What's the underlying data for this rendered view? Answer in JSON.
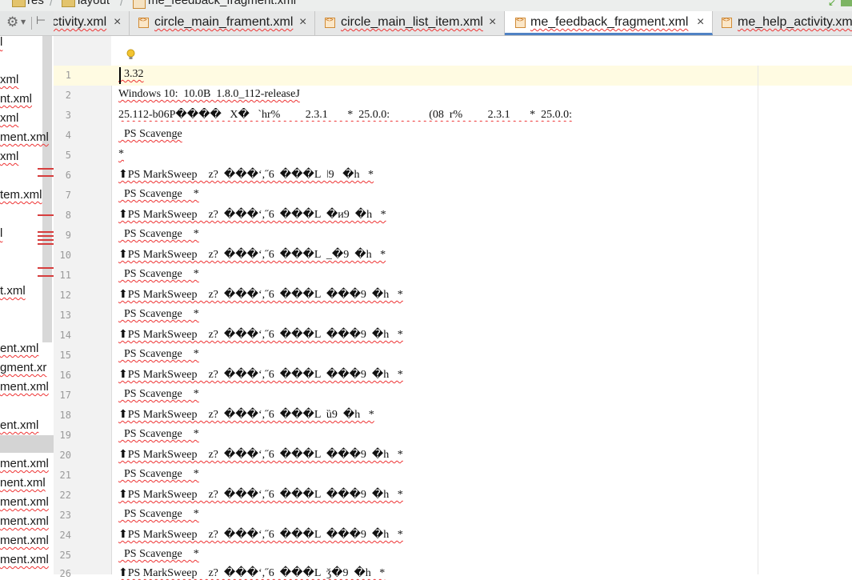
{
  "breadcrumbs": [
    "res",
    "layout",
    "me_feedback_fragment.xml"
  ],
  "tabs": [
    {
      "label": "ctivity.xml",
      "active": false
    },
    {
      "label": "circle_main_frament.xml",
      "active": false
    },
    {
      "label": "circle_main_list_item.xml",
      "active": false
    },
    {
      "label": "me_feedback_fragment.xml",
      "active": true
    },
    {
      "label": "me_help_activity.xm",
      "active": false
    }
  ],
  "tab_close_glyph": "×",
  "tree_items": [
    {
      "label": "l"
    },
    {
      "label": "xml"
    },
    {
      "label": "nt.xml"
    },
    {
      "label": "xml"
    },
    {
      "label": "ment.xml"
    },
    {
      "label": "xml"
    },
    {
      "label": "tem.xml"
    },
    {
      "label": "l"
    },
    {
      "label": "t.xml"
    },
    {
      "label": "ent.xml"
    },
    {
      "label": "gment.xr"
    },
    {
      "label": "ment.xml"
    },
    {
      "label": "ent.xml"
    },
    {
      "label": "ment.xml"
    },
    {
      "label": "nent.xml"
    },
    {
      "label": "ment.xml"
    },
    {
      "label": "ment.xml"
    },
    {
      "label": "ment.xml"
    },
    {
      "label": "ment.xml"
    }
  ],
  "line_numbers": [
    "1",
    "2",
    "3",
    "4",
    "5",
    "6",
    "7",
    "8",
    "9",
    "10",
    "11",
    "12",
    "13",
    "14",
    "15",
    "16",
    "17",
    "18",
    "19",
    "20",
    "21",
    "22",
    "23",
    "24",
    "25",
    "26"
  ],
  "code_lines": [
    "  3.32",
    "Windows 10:  10.0B  1.8.0_112-releaseJ",
    "25.112-b06P����   X�   `hr%         2.3.1       *  25.0.0:              (08  r%         2.3.1       *  25.0.0:",
    "  PS Scavenge",
    "*",
    "⬆PS MarkSweep    z?  ���ʻ,˝6  ���L  ǀ9   �h   *",
    "  PS Scavenge    *",
    "⬆PS MarkSweep    z?  ���ʻ,˝6  ���L  �и9  �h   *",
    "  PS Scavenge    *",
    "⬆PS MarkSweep    z?  ���ʻ,˝6  ���L  _�9  �h   *",
    "  PS Scavenge    *",
    "⬆PS MarkSweep    z?  ���ʻ,˝6  ���L  ���9  �h   *",
    "  PS Scavenge    *",
    "⬆PS MarkSweep    z?  ���ʻ,˝6  ���L  ���9  �h   *",
    "  PS Scavenge    *",
    "⬆PS MarkSweep    z?  ���ʻ,˝6  ���L  ���9  �h   *",
    "  PS Scavenge    *",
    "⬆PS MarkSweep    z?  ���ʻ,˝6  ���L  ȕ9  �h   *",
    "  PS Scavenge    *",
    "⬆PS MarkSweep    z?  ���ʻ,˝6  ���L  ���9  �h   *",
    "  PS Scavenge    *",
    "⬆PS MarkSweep    z?  ���ʻ,˝6  ���L  ���9  �h   *",
    "  PS Scavenge    *",
    "⬆PS MarkSweep    z?  ���ʻ,˝6  ���L  ���9  �h   *",
    "  PS Scavenge    *",
    "⬆PS MarkSweep    z?  ���ʻ,˝6  ���L  ǯ�9  �h   *"
  ],
  "colors": {
    "accent": "#4f82c4",
    "error": "#e33333",
    "current_line": "#fffbe2"
  }
}
